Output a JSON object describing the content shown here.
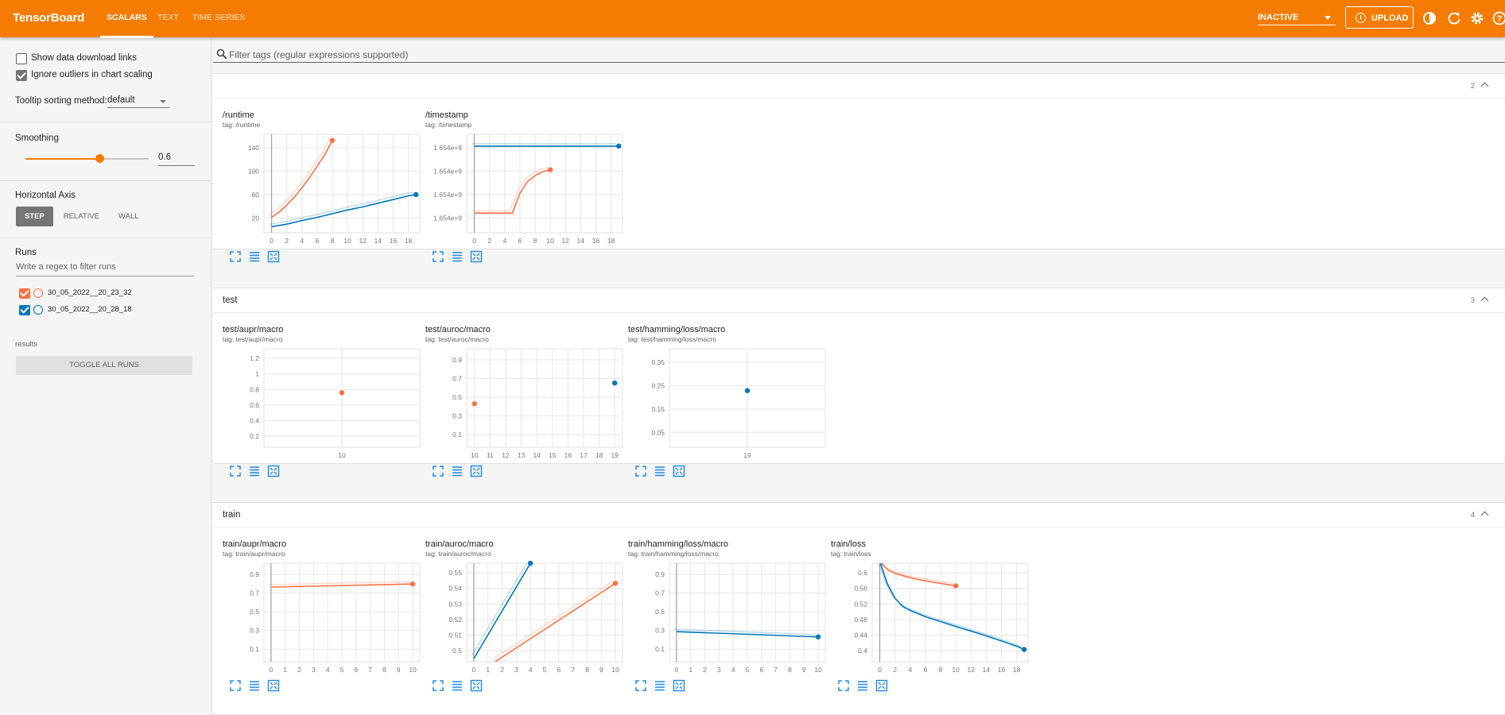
{
  "topbar": {
    "brand": "TensorBoard",
    "tabs": [
      {
        "label": "SCALARS",
        "active": true
      },
      {
        "label": "TEXT",
        "active": false
      },
      {
        "label": "TIME SERIES",
        "active": false
      }
    ],
    "reload_status": "INACTIVE",
    "upload_label": "UPLOAD",
    "icons": [
      "theme-icon",
      "refresh-icon",
      "settings-icon",
      "help-icon"
    ],
    "accent_color": "#f57c00"
  },
  "sidebar": {
    "show_download_links": {
      "label": "Show data download links",
      "checked": false
    },
    "ignore_outliers": {
      "label": "Ignore outliers in chart scaling",
      "checked": true
    },
    "tooltip_sorting": {
      "label": "Tooltip sorting method:",
      "value": "default"
    },
    "smoothing": {
      "label": "Smoothing",
      "value": "0.6",
      "fraction": 0.6
    },
    "horizontal_axis": {
      "label": "Horizontal Axis",
      "options": [
        "STEP",
        "RELATIVE",
        "WALL"
      ],
      "selected": "STEP"
    },
    "runs": {
      "label": "Runs",
      "filter_placeholder": "Write a regex to filter runs",
      "items": [
        {
          "name": "30_05_2022__20_23_32",
          "color": "#ff7043",
          "checked": true
        },
        {
          "name": "30_05_2022__20_28_18",
          "color": "#0077bb",
          "checked": true
        }
      ],
      "toggle_all_label": "TOGGLE ALL RUNS",
      "footer": "results"
    }
  },
  "filter": {
    "placeholder": "Filter tags (regular expressions supported)"
  },
  "groups": [
    {
      "title": "",
      "count": "2"
    },
    {
      "title": "test",
      "count": "3"
    },
    {
      "title": "train",
      "count": "4"
    }
  ],
  "charts": [
    {
      "title": "/runtime",
      "tag": "tag: /runtime"
    },
    {
      "title": "/timestamp",
      "tag": "tag: /timestamp"
    },
    {
      "title": "test/aupr/macro",
      "tag": "tag: test/aupr/macro"
    },
    {
      "title": "test/auroc/macro",
      "tag": "tag: test/auroc/macro"
    },
    {
      "title": "test/hamming/loss/macro",
      "tag": "tag: test/hamming/loss/macro"
    },
    {
      "title": "train/aupr/macro",
      "tag": "tag: train/aupr/macro"
    },
    {
      "title": "train/auroc/macro",
      "tag": "tag: train/auroc/macro"
    },
    {
      "title": "train/hamming/loss/macro",
      "tag": "tag: train/hamming/loss/macro"
    },
    {
      "title": "train/loss",
      "tag": "tag: train/loss"
    }
  ],
  "chart_data": [
    {
      "type": "line",
      "title": "/runtime",
      "x_ticks": [
        "0",
        "2",
        "4",
        "6",
        "8",
        "10",
        "12",
        "14",
        "16",
        "18"
      ],
      "y_ticks": [
        "20",
        "60",
        "100",
        "140"
      ],
      "xlim": [
        -1,
        19.5
      ],
      "ylim": [
        0,
        160
      ],
      "series": [
        {
          "name": "30_05_2022__20_23_32",
          "color": "#ff7043",
          "x": [
            0,
            1,
            2,
            3,
            4,
            5,
            6,
            7,
            8
          ],
          "y": [
            25,
            34,
            45,
            58,
            73,
            90,
            108,
            127,
            150
          ]
        },
        {
          "name": "30_05_2022__20_28_18",
          "color": "#0077bb",
          "x": [
            0,
            2,
            4,
            6,
            8,
            10,
            12,
            14,
            16,
            18,
            19
          ],
          "y": [
            10,
            14,
            20,
            25,
            31,
            37,
            42,
            48,
            54,
            60,
            62
          ]
        }
      ]
    },
    {
      "type": "line",
      "title": "/timestamp",
      "x_ticks": [
        "0",
        "2",
        "4",
        "6",
        "8",
        "10",
        "12",
        "14",
        "16",
        "18"
      ],
      "y_ticks": [
        "1.654e+9",
        "1.654e+9",
        "1.654e+9",
        "1.654e+9"
      ],
      "xlim": [
        -1,
        19.5
      ],
      "ylim": [
        0,
        100
      ],
      "series": [
        {
          "name": "30_05_2022__20_23_32",
          "color": "#ff7043",
          "x": [
            0,
            1,
            2,
            3,
            4,
            5,
            6,
            7,
            8,
            9,
            10
          ],
          "y": [
            20,
            20,
            20,
            20,
            20,
            20,
            40,
            52,
            58,
            62,
            64
          ]
        },
        {
          "name": "30_05_2022__20_28_18",
          "color": "#0077bb",
          "x": [
            0,
            19
          ],
          "y": [
            88,
            88
          ]
        }
      ]
    },
    {
      "type": "scatter",
      "title": "test/aupr/macro",
      "x_ticks": [
        "10"
      ],
      "y_ticks": [
        "0.2",
        "0.4",
        "0.6",
        "0.8",
        "1",
        "1.2"
      ],
      "xlim": [
        0,
        20
      ],
      "ylim": [
        0,
        1.3
      ],
      "series": [
        {
          "name": "30_05_2022__20_23_32",
          "color": "#ff7043",
          "x": [
            10
          ],
          "y": [
            0.72
          ]
        }
      ]
    },
    {
      "type": "scatter",
      "title": "test/auroc/macro",
      "x_ticks": [
        "10",
        "11",
        "12",
        "13",
        "14",
        "15",
        "16",
        "17",
        "18",
        "19"
      ],
      "y_ticks": [
        "0.1",
        "0.3",
        "0.5",
        "0.7",
        "0.9"
      ],
      "xlim": [
        9.5,
        19.5
      ],
      "ylim": [
        0,
        0.95
      ],
      "series": [
        {
          "name": "30_05_2022__20_23_32",
          "color": "#ff7043",
          "x": [
            10
          ],
          "y": [
            0.42
          ]
        },
        {
          "name": "30_05_2022__20_28_18",
          "color": "#0077bb",
          "x": [
            19
          ],
          "y": [
            0.62
          ]
        }
      ]
    },
    {
      "type": "scatter",
      "title": "test/hamming/loss/macro",
      "x_ticks": [
        "19"
      ],
      "y_ticks": [
        "0.05",
        "0.15",
        "0.25",
        "0.35"
      ],
      "xlim": [
        0,
        38
      ],
      "ylim": [
        0,
        0.4
      ],
      "series": [
        {
          "name": "30_05_2022__20_28_18",
          "color": "#0077bb",
          "x": [
            19
          ],
          "y": [
            0.23
          ]
        }
      ]
    },
    {
      "type": "line",
      "title": "train/aupr/macro",
      "x_ticks": [
        "0",
        "1",
        "2",
        "3",
        "4",
        "5",
        "6",
        "7",
        "8",
        "9",
        "10"
      ],
      "y_ticks": [
        "0.1",
        "0.3",
        "0.5",
        "0.7",
        "0.9"
      ],
      "xlim": [
        -0.5,
        10.5
      ],
      "ylim": [
        0,
        0.95
      ],
      "series": [
        {
          "name": "30_05_2022__20_23_32",
          "color": "#ff7043",
          "x": [
            0,
            10
          ],
          "y": [
            0.72,
            0.75
          ]
        }
      ]
    },
    {
      "type": "line",
      "title": "train/auroc/macro",
      "x_ticks": [
        "0",
        "1",
        "2",
        "3",
        "4",
        "5",
        "6",
        "7",
        "8",
        "9",
        "10"
      ],
      "y_ticks": [
        "0.5",
        "0.51",
        "0.52",
        "0.53",
        "0.54",
        "0.55"
      ],
      "xlim": [
        -0.5,
        10.5
      ],
      "ylim": [
        0.496,
        0.56
      ],
      "series": [
        {
          "name": "30_05_2022__20_23_32",
          "color": "#ff7043",
          "x": [
            1.5,
            10
          ],
          "y": [
            0.496,
            0.547
          ]
        },
        {
          "name": "30_05_2022__20_28_18",
          "color": "#0077bb",
          "x": [
            0,
            4
          ],
          "y": [
            0.498,
            0.56
          ]
        }
      ]
    },
    {
      "type": "line",
      "title": "train/hamming/loss/macro",
      "x_ticks": [
        "0",
        "1",
        "2",
        "3",
        "4",
        "5",
        "6",
        "7",
        "8",
        "9",
        "10"
      ],
      "y_ticks": [
        "0.1",
        "0.3",
        "0.5",
        "0.7",
        "0.9"
      ],
      "xlim": [
        -0.5,
        10.5
      ],
      "ylim": [
        0,
        0.95
      ],
      "series": [
        {
          "name": "30_05_2022__20_28_18",
          "color": "#0077bb",
          "x": [
            0,
            10
          ],
          "y": [
            0.29,
            0.24
          ]
        }
      ]
    },
    {
      "type": "line",
      "title": "train/loss",
      "x_ticks": [
        "0",
        "2",
        "4",
        "6",
        "8",
        "10",
        "12",
        "14",
        "16",
        "18"
      ],
      "y_ticks": [
        "0.4",
        "0.44",
        "0.48",
        "0.52",
        "0.56",
        "0.6"
      ],
      "xlim": [
        -1,
        19.5
      ],
      "ylim": [
        0.38,
        0.62
      ],
      "series": [
        {
          "name": "30_05_2022__20_23_32",
          "color": "#ff7043",
          "x": [
            0,
            1,
            2,
            4,
            6,
            8,
            10
          ],
          "y": [
            0.625,
            0.605,
            0.595,
            0.585,
            0.577,
            0.571,
            0.565
          ]
        },
        {
          "name": "30_05_2022__20_28_18",
          "color": "#0077bb",
          "x": [
            0,
            1,
            2,
            3,
            4,
            6,
            8,
            10,
            12,
            14,
            16,
            18,
            19
          ],
          "y": [
            0.625,
            0.57,
            0.535,
            0.515,
            0.505,
            0.49,
            0.478,
            0.466,
            0.455,
            0.443,
            0.431,
            0.418,
            0.41
          ]
        }
      ]
    }
  ]
}
